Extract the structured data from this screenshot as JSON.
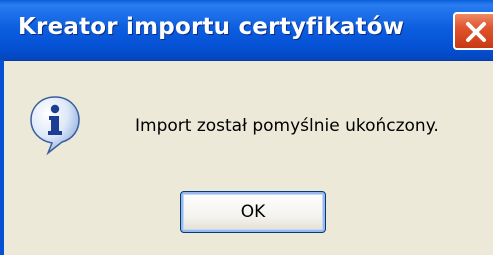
{
  "window": {
    "title": "Kreator importu certyfikatów"
  },
  "dialog": {
    "message": "Import został pomyślnie ukończony.",
    "icon": "info-icon",
    "ok_label": "OK"
  },
  "colors": {
    "titlebar": "#0550d4",
    "close_button": "#e0552e",
    "background": "#ece9d8"
  }
}
